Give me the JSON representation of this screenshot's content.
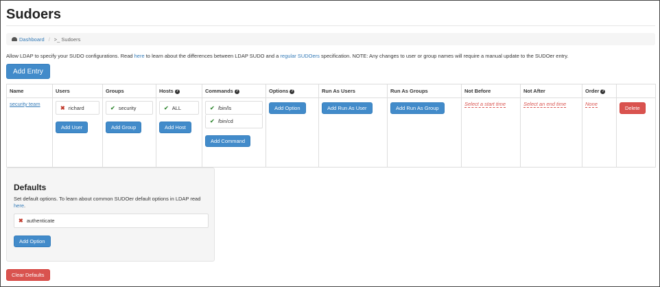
{
  "page": {
    "title": "Sudoers",
    "breadcrumb": {
      "home": "Dashboard",
      "separator": "/",
      "current": ">_ Sudoers"
    },
    "intro": {
      "part1": "Allow LDAP to specify your SUDO configurations. Read ",
      "link1": "here",
      "part2": " to learn about the differences between LDAP SUDO and a ",
      "link2": "regular SUDOers",
      "part3": " specification. NOTE: Any changes to user or group names will require a manual update to the SUDOer entry."
    },
    "add_entry_label": "Add Entry"
  },
  "table": {
    "headers": {
      "name": "Name",
      "users": "Users",
      "groups": "Groups",
      "hosts": "Hosts",
      "commands": "Commands",
      "options": "Options",
      "run_as_users": "Run As Users",
      "run_as_groups": "Run As Groups",
      "not_before": "Not Before",
      "not_after": "Not After",
      "order": "Order"
    },
    "row": {
      "name": "security team",
      "users": [
        "richard"
      ],
      "groups": [
        "security"
      ],
      "hosts": [
        "ALL"
      ],
      "commands": [
        "/bin/ls",
        "/bin/cd"
      ],
      "not_before": "Select a start time",
      "not_after": "Select an end time",
      "order": "None"
    },
    "buttons": {
      "add_user": "Add User",
      "add_group": "Add Group",
      "add_host": "Add Host",
      "add_command": "Add Command",
      "add_option": "Add Option",
      "add_run_as_user": "Add Run As User",
      "add_run_as_group": "Add Run As Group",
      "delete": "Delete"
    }
  },
  "defaults": {
    "title": "Defaults",
    "desc": "Set default options. To learn about common SUDOer default options in LDAP read ",
    "desc_link": "here",
    "desc_end": ".",
    "items": [
      "authenticate"
    ],
    "add_option": "Add Option",
    "clear": "Clear Defaults"
  },
  "icons": {
    "help": "?",
    "remove": "✖",
    "check": "✔"
  },
  "colors": {
    "primary": "#428bca",
    "danger": "#d9534f",
    "link": "#337ab7"
  }
}
